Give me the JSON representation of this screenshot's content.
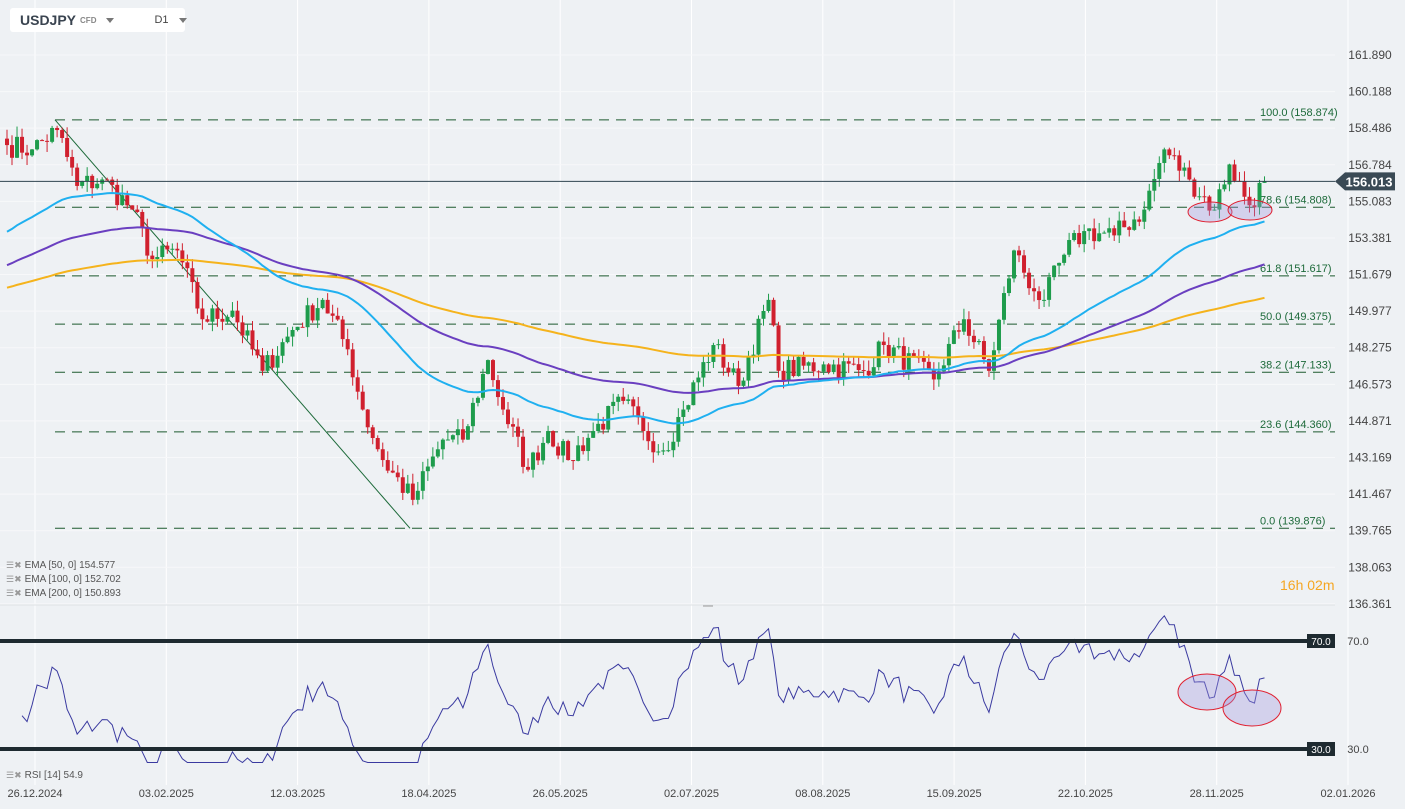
{
  "header": {
    "symbol": "USDJPY",
    "type": "CFD",
    "timeframe": "D1"
  },
  "indicators": [
    {
      "label": "EMA [50, 0]",
      "value": "154.577",
      "color": "#1fb0f0"
    },
    {
      "label": "EMA [100, 0]",
      "value": "152.702",
      "color": "#6a3fc0"
    },
    {
      "label": "EMA [200, 0]",
      "value": "150.893",
      "color": "#f5b31c"
    }
  ],
  "rsi_label": {
    "label": "RSI [14]",
    "value": "54.9"
  },
  "timer": {
    "hours": "16h",
    "minutes": "02m"
  },
  "chart_data": {
    "type": "candlestick",
    "price_axis": [
      "161.890",
      "160.188",
      "158.486",
      "156.784",
      "155.083",
      "153.381",
      "151.679",
      "149.977",
      "148.275",
      "146.573",
      "144.871",
      "143.169",
      "141.467",
      "139.765",
      "138.063",
      "136.361"
    ],
    "ylim": [
      136.361,
      161.89
    ],
    "current_price": "156.013",
    "date_axis": [
      "26.12.2024",
      "03.02.2025",
      "12.03.2025",
      "18.04.2025",
      "26.05.2025",
      "02.07.2025",
      "08.08.2025",
      "15.09.2025",
      "22.10.2025",
      "28.11.2025",
      "02.01.2026"
    ],
    "fib_levels": [
      {
        "label": "100.0 (158.874)",
        "value": 158.874
      },
      {
        "label": "78.6 (154.808)",
        "value": 154.808
      },
      {
        "label": "61.8 (151.617)",
        "value": 151.617
      },
      {
        "label": "50.0 (149.375)",
        "value": 149.375
      },
      {
        "label": "38.2 (147.133)",
        "value": 147.133
      },
      {
        "label": "23.6 (144.360)",
        "value": 144.36
      },
      {
        "label": "0.0 (139.876)",
        "value": 139.876
      }
    ],
    "close_anchors_bar_price": [
      [
        0,
        157.7
      ],
      [
        5,
        157.5
      ],
      [
        10,
        158.4
      ],
      [
        14,
        155.8
      ],
      [
        19,
        156.1
      ],
      [
        25,
        154.7
      ],
      [
        29,
        152.4
      ],
      [
        34,
        152.8
      ],
      [
        39,
        149.6
      ],
      [
        45,
        150.0
      ],
      [
        51,
        147.2
      ],
      [
        57,
        149.1
      ],
      [
        63,
        150.5
      ],
      [
        68,
        148.2
      ],
      [
        71,
        145.4
      ],
      [
        75,
        143.05
      ],
      [
        81,
        141.2
      ],
      [
        87,
        144.0
      ],
      [
        91,
        144.0
      ],
      [
        96,
        147.7
      ],
      [
        99,
        145.4
      ],
      [
        104,
        142.6
      ],
      [
        108,
        144.4
      ],
      [
        112,
        143.05
      ],
      [
        117,
        144.4
      ],
      [
        123,
        145.8
      ],
      [
        127,
        144.4
      ],
      [
        131,
        143.5
      ],
      [
        135,
        145.4
      ],
      [
        141,
        148.4
      ],
      [
        146,
        146.5
      ],
      [
        152,
        150.5
      ],
      [
        154,
        147.2
      ],
      [
        163,
        147.5
      ],
      [
        171,
        147.2
      ],
      [
        175,
        148.4
      ],
      [
        185,
        146.8
      ],
      [
        191,
        149.6
      ],
      [
        196,
        147.2
      ],
      [
        201,
        152.8
      ],
      [
        205,
        150.9
      ],
      [
        207,
        150.5
      ],
      [
        211,
        152.6
      ],
      [
        215,
        153.7
      ],
      [
        221,
        153.5
      ],
      [
        227,
        154.7
      ],
      [
        231,
        157.5
      ],
      [
        236,
        156.1
      ],
      [
        241,
        154.7
      ],
      [
        244,
        156.8
      ],
      [
        248,
        154.9
      ],
      [
        251,
        156.013
      ]
    ],
    "ema_start": {
      "ema50": 153.5,
      "ema100": 152.0,
      "ema200": 151.0
    },
    "rsi": {
      "levels": [
        "70.0",
        "30.0"
      ],
      "ylim": [
        30,
        70
      ]
    }
  }
}
